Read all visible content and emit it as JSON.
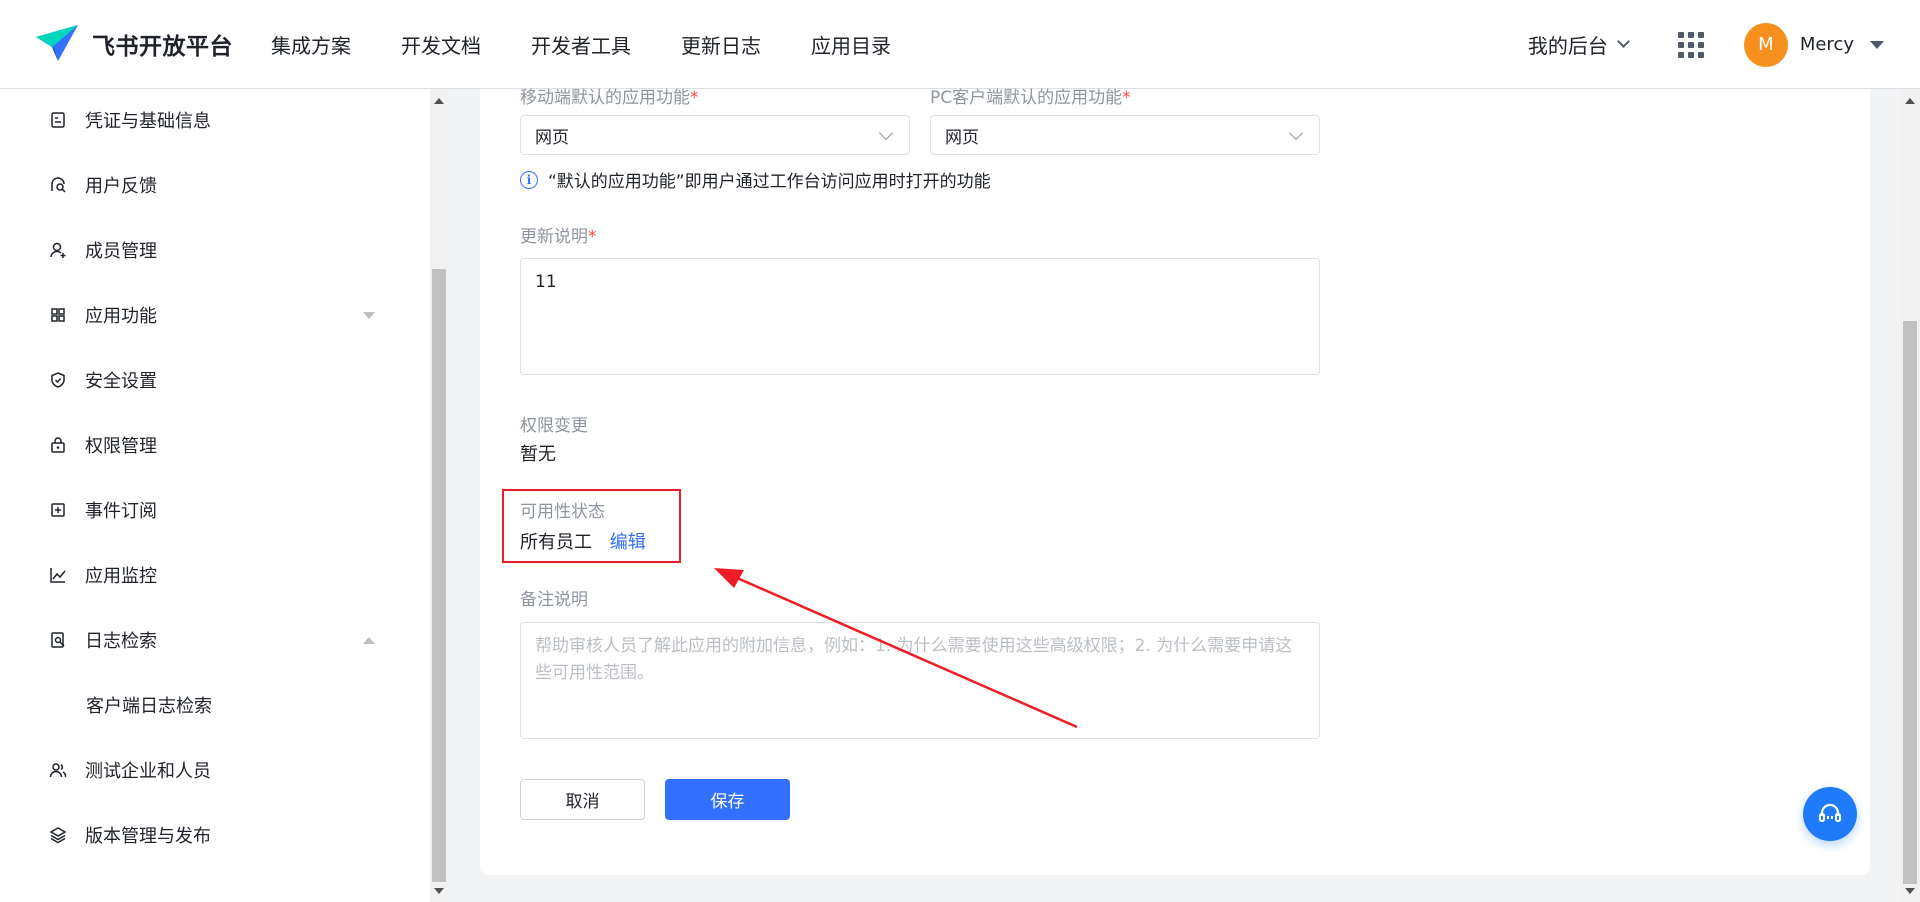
{
  "header": {
    "brand_name": "飞书开放平台",
    "nav": [
      "集成方案",
      "开发文档",
      "开发者工具",
      "更新日志",
      "应用目录"
    ],
    "console_label": "我的后台",
    "avatar_initial": "M",
    "username": "Mercy"
  },
  "sidebar": {
    "items": [
      {
        "label": "凭证与基础信息",
        "icon": "credential-icon"
      },
      {
        "label": "用户反馈",
        "icon": "feedback-icon"
      },
      {
        "label": "成员管理",
        "icon": "member-add-icon"
      },
      {
        "label": "应用功能",
        "icon": "app-grid-icon",
        "expand": "collapsed"
      },
      {
        "label": "安全设置",
        "icon": "shield-icon"
      },
      {
        "label": "权限管理",
        "icon": "permission-lock-icon"
      },
      {
        "label": "事件订阅",
        "icon": "event-subscribe-icon"
      },
      {
        "label": "应用监控",
        "icon": "chart-line-icon"
      },
      {
        "label": "日志检索",
        "icon": "log-search-icon",
        "expand": "expanded"
      },
      {
        "label": "客户端日志检索",
        "sub": true
      },
      {
        "label": "测试企业和人员",
        "icon": "test-users-icon"
      },
      {
        "label": "版本管理与发布",
        "icon": "layers-icon"
      }
    ]
  },
  "form": {
    "mobile_default_label": "移动端默认的应用功能",
    "pc_default_label": "PC客户端默认的应用功能",
    "required_mark": "*",
    "mobile_default_value": "网页",
    "pc_default_value": "网页",
    "default_hint": "“默认的应用功能”即用户通过工作台访问应用时打开的功能",
    "info_icon_glyph": "i",
    "update_notes_label": "更新说明",
    "update_notes_value": "11",
    "permission_change_label": "权限变更",
    "permission_change_value": "暂无",
    "availability_label": "可用性状态",
    "availability_value": "所有员工",
    "availability_edit": "编辑",
    "remark_label": "备注说明",
    "remark_placeholder": "帮助审核人员了解此应用的附加信息，例如：1. 为什么需要使用这些高级权限；2. 为什么需要申请这些可用性范围。"
  },
  "actions": {
    "cancel": "取消",
    "save": "保存"
  },
  "colors": {
    "primary": "#3370ff",
    "annotation": "#ee1c25",
    "required": "#f54a45",
    "avatar": "#f5901e"
  }
}
